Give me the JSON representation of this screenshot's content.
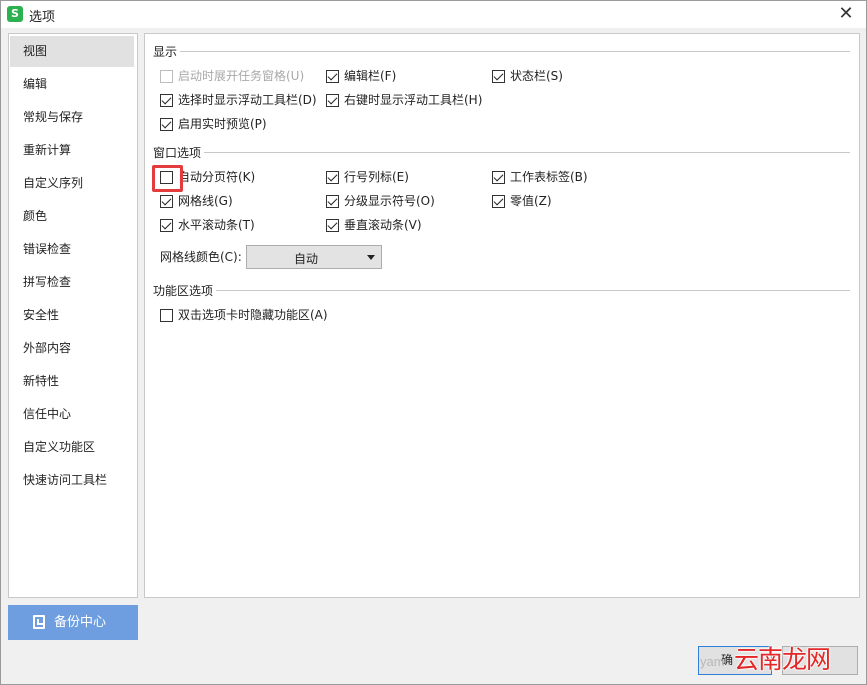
{
  "window": {
    "title": "选项",
    "app_icon_glyph": "S"
  },
  "sidebar": {
    "items": [
      {
        "label": "视图",
        "active": true
      },
      {
        "label": "编辑"
      },
      {
        "label": "常规与保存"
      },
      {
        "label": "重新计算"
      },
      {
        "label": "自定义序列"
      },
      {
        "label": "颜色"
      },
      {
        "label": "错误检查"
      },
      {
        "label": "拼写检查"
      },
      {
        "label": "安全性"
      },
      {
        "label": "外部内容"
      },
      {
        "label": "新特性"
      },
      {
        "label": "信任中心"
      },
      {
        "label": "自定义功能区"
      },
      {
        "label": "快速访问工具栏"
      }
    ],
    "backup_label": "备份中心"
  },
  "display": {
    "title": "显示",
    "options": [
      {
        "label": "启动时展开任务窗格(U)",
        "checked": false,
        "disabled": true
      },
      {
        "label": "编辑栏(F)",
        "checked": true
      },
      {
        "label": "状态栏(S)",
        "checked": true
      },
      {
        "label": "选择时显示浮动工具栏(D)",
        "checked": true
      },
      {
        "label": "右键时显示浮动工具栏(H)",
        "checked": true
      },
      {
        "label": "启用实时预览(P)",
        "checked": true
      }
    ]
  },
  "window_options": {
    "title": "窗口选项",
    "options": [
      {
        "label": "自动分页符(K)",
        "checked": false
      },
      {
        "label": "行号列标(E)",
        "checked": true
      },
      {
        "label": "工作表标签(B)",
        "checked": true
      },
      {
        "label": "网格线(G)",
        "checked": true
      },
      {
        "label": "分级显示符号(O)",
        "checked": true
      },
      {
        "label": "零值(Z)",
        "checked": true
      },
      {
        "label": "水平滚动条(T)",
        "checked": true
      },
      {
        "label": "垂直滚动条(V)",
        "checked": true
      }
    ],
    "grid_color_label": "网格线颜色(C):",
    "grid_color_value": "自动"
  },
  "ribbon": {
    "title": "功能区选项",
    "options": [
      {
        "label": "双击选项卡时隐藏功能区(A)",
        "checked": false
      }
    ]
  },
  "footer": {
    "ok_label": "确",
    "watermark_small": "yam",
    "watermark_big": "云南龙网"
  },
  "colors": {
    "highlight": "#e23c3c",
    "backup_button": "#6e9ee0",
    "watermark": "#e32626"
  }
}
